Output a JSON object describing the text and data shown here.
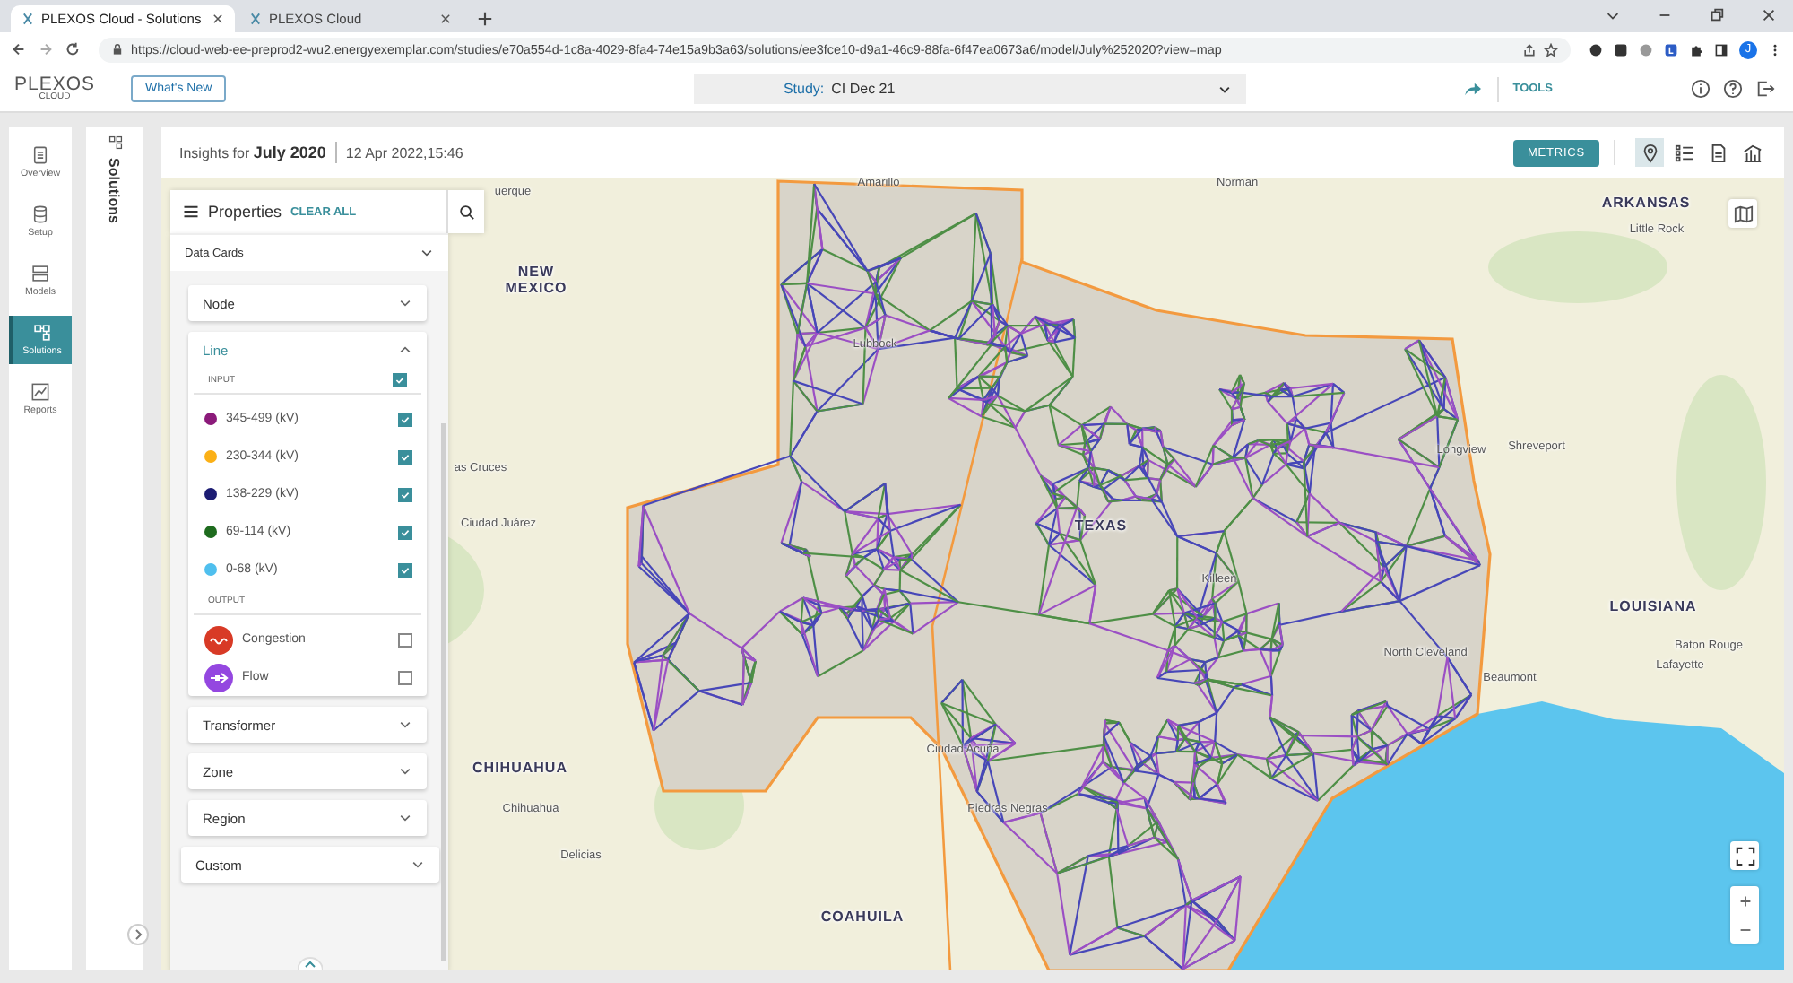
{
  "browser": {
    "tabs": [
      {
        "title": "PLEXOS Cloud - Solutions",
        "selected": true
      },
      {
        "title": "PLEXOS Cloud",
        "selected": false
      }
    ],
    "url": "https://cloud-web-ee-preprod2-wu2.energyexemplar.com/studies/e70a554d-1c8a-4029-8fa4-74e15a9b3a63/solutions/ee3fce10-d9a1-46c9-88fa-6f47ea0673a6/model/July%252020?view=map",
    "profile": "J"
  },
  "header": {
    "logo": "PLEXOS",
    "logo_sub": "CLOUD",
    "whats_new": "What's New",
    "study_label": "Study:",
    "study_value": "CI Dec 21",
    "tools": "TOOLS"
  },
  "nav": {
    "items": [
      {
        "label": "Overview",
        "kind": "overview",
        "selected": false
      },
      {
        "label": "Setup",
        "kind": "setup",
        "selected": false
      },
      {
        "label": "Models",
        "kind": "models",
        "selected": false
      },
      {
        "label": "Solutions",
        "kind": "solutions",
        "selected": true
      },
      {
        "label": "Reports",
        "kind": "reports",
        "selected": false
      }
    ]
  },
  "solutions_panel": {
    "title": "Solutions"
  },
  "insights": {
    "prefix": "Insights for",
    "period": "July 2020",
    "timestamp": "12 Apr 2022,15:46"
  },
  "toolbar": {
    "metrics": "METRICS",
    "views": [
      {
        "kind": "map",
        "selected": true
      },
      {
        "kind": "list",
        "selected": false
      },
      {
        "kind": "document",
        "selected": false
      },
      {
        "kind": "chart",
        "selected": false
      }
    ]
  },
  "properties": {
    "title": "Properties",
    "clear_all": "CLEAR ALL",
    "data_cards": "Data Cards",
    "groups": [
      {
        "label": "Node",
        "kind": "category",
        "expanded": false
      },
      {
        "label": "Line",
        "kind": "category",
        "expanded": true,
        "sections": [
          {
            "heading": "INPUT",
            "checked": true,
            "items": [
              {
                "label": "345-499 (kV)",
                "kind": "dot",
                "color": "#8b1a7a",
                "checked": true
              },
              {
                "label": "230-344 (kV)",
                "kind": "dot",
                "color": "#fbb016",
                "checked": true
              },
              {
                "label": "138-229 (kV)",
                "kind": "dot",
                "color": "#1c1c73",
                "checked": true
              },
              {
                "label": "69-114 (kV)",
                "kind": "dot",
                "color": "#1e6b1e",
                "checked": true
              },
              {
                "label": "0-68 (kV)",
                "kind": "dot",
                "color": "#4fbfee",
                "checked": true
              }
            ]
          },
          {
            "heading": "OUTPUT",
            "items": [
              {
                "label": "Congestion",
                "kind": "congestion",
                "color": "#d83a26",
                "checked": false
              },
              {
                "label": "Flow",
                "kind": "flow",
                "color": "#9447e0",
                "checked": false
              }
            ]
          }
        ]
      },
      {
        "label": "Transformer",
        "kind": "category",
        "expanded": false
      },
      {
        "label": "Zone",
        "kind": "category",
        "expanded": false
      },
      {
        "label": "Region",
        "kind": "category",
        "expanded": false
      },
      {
        "label": "Custom",
        "kind": "custom",
        "expanded": false
      }
    ]
  },
  "map": {
    "labels": [
      {
        "text": "uerque",
        "kind": "city"
      },
      {
        "text": "NEW MEXICO",
        "kind": "region"
      },
      {
        "text": "Amarillo",
        "kind": "city"
      },
      {
        "text": "Norman",
        "kind": "city"
      },
      {
        "text": "ARKANSAS",
        "kind": "region"
      },
      {
        "text": "Little Rock",
        "kind": "city"
      },
      {
        "text": "Lubbock",
        "kind": "city"
      },
      {
        "text": "as Cruces",
        "kind": "city"
      },
      {
        "text": "Ciudad Juárez",
        "kind": "city"
      },
      {
        "text": "TEXAS",
        "kind": "region"
      },
      {
        "text": "Longview",
        "kind": "city"
      },
      {
        "text": "Shreveport",
        "kind": "city"
      },
      {
        "text": "Killeen",
        "kind": "city"
      },
      {
        "text": "LOUISIANA",
        "kind": "region"
      },
      {
        "text": "North Cleveland",
        "kind": "city"
      },
      {
        "text": "Baton Rouge",
        "kind": "city"
      },
      {
        "text": "Beaumont",
        "kind": "city"
      },
      {
        "text": "Lafayette",
        "kind": "city"
      },
      {
        "text": "Ciudad Acuña",
        "kind": "city"
      },
      {
        "text": "CHIHUAHUA",
        "kind": "region"
      },
      {
        "text": "Chihuahua",
        "kind": "city"
      },
      {
        "text": "Piedras Negras",
        "kind": "city"
      },
      {
        "text": "Delicias",
        "kind": "city"
      },
      {
        "text": "COAHUILA",
        "kind": "region"
      }
    ]
  }
}
